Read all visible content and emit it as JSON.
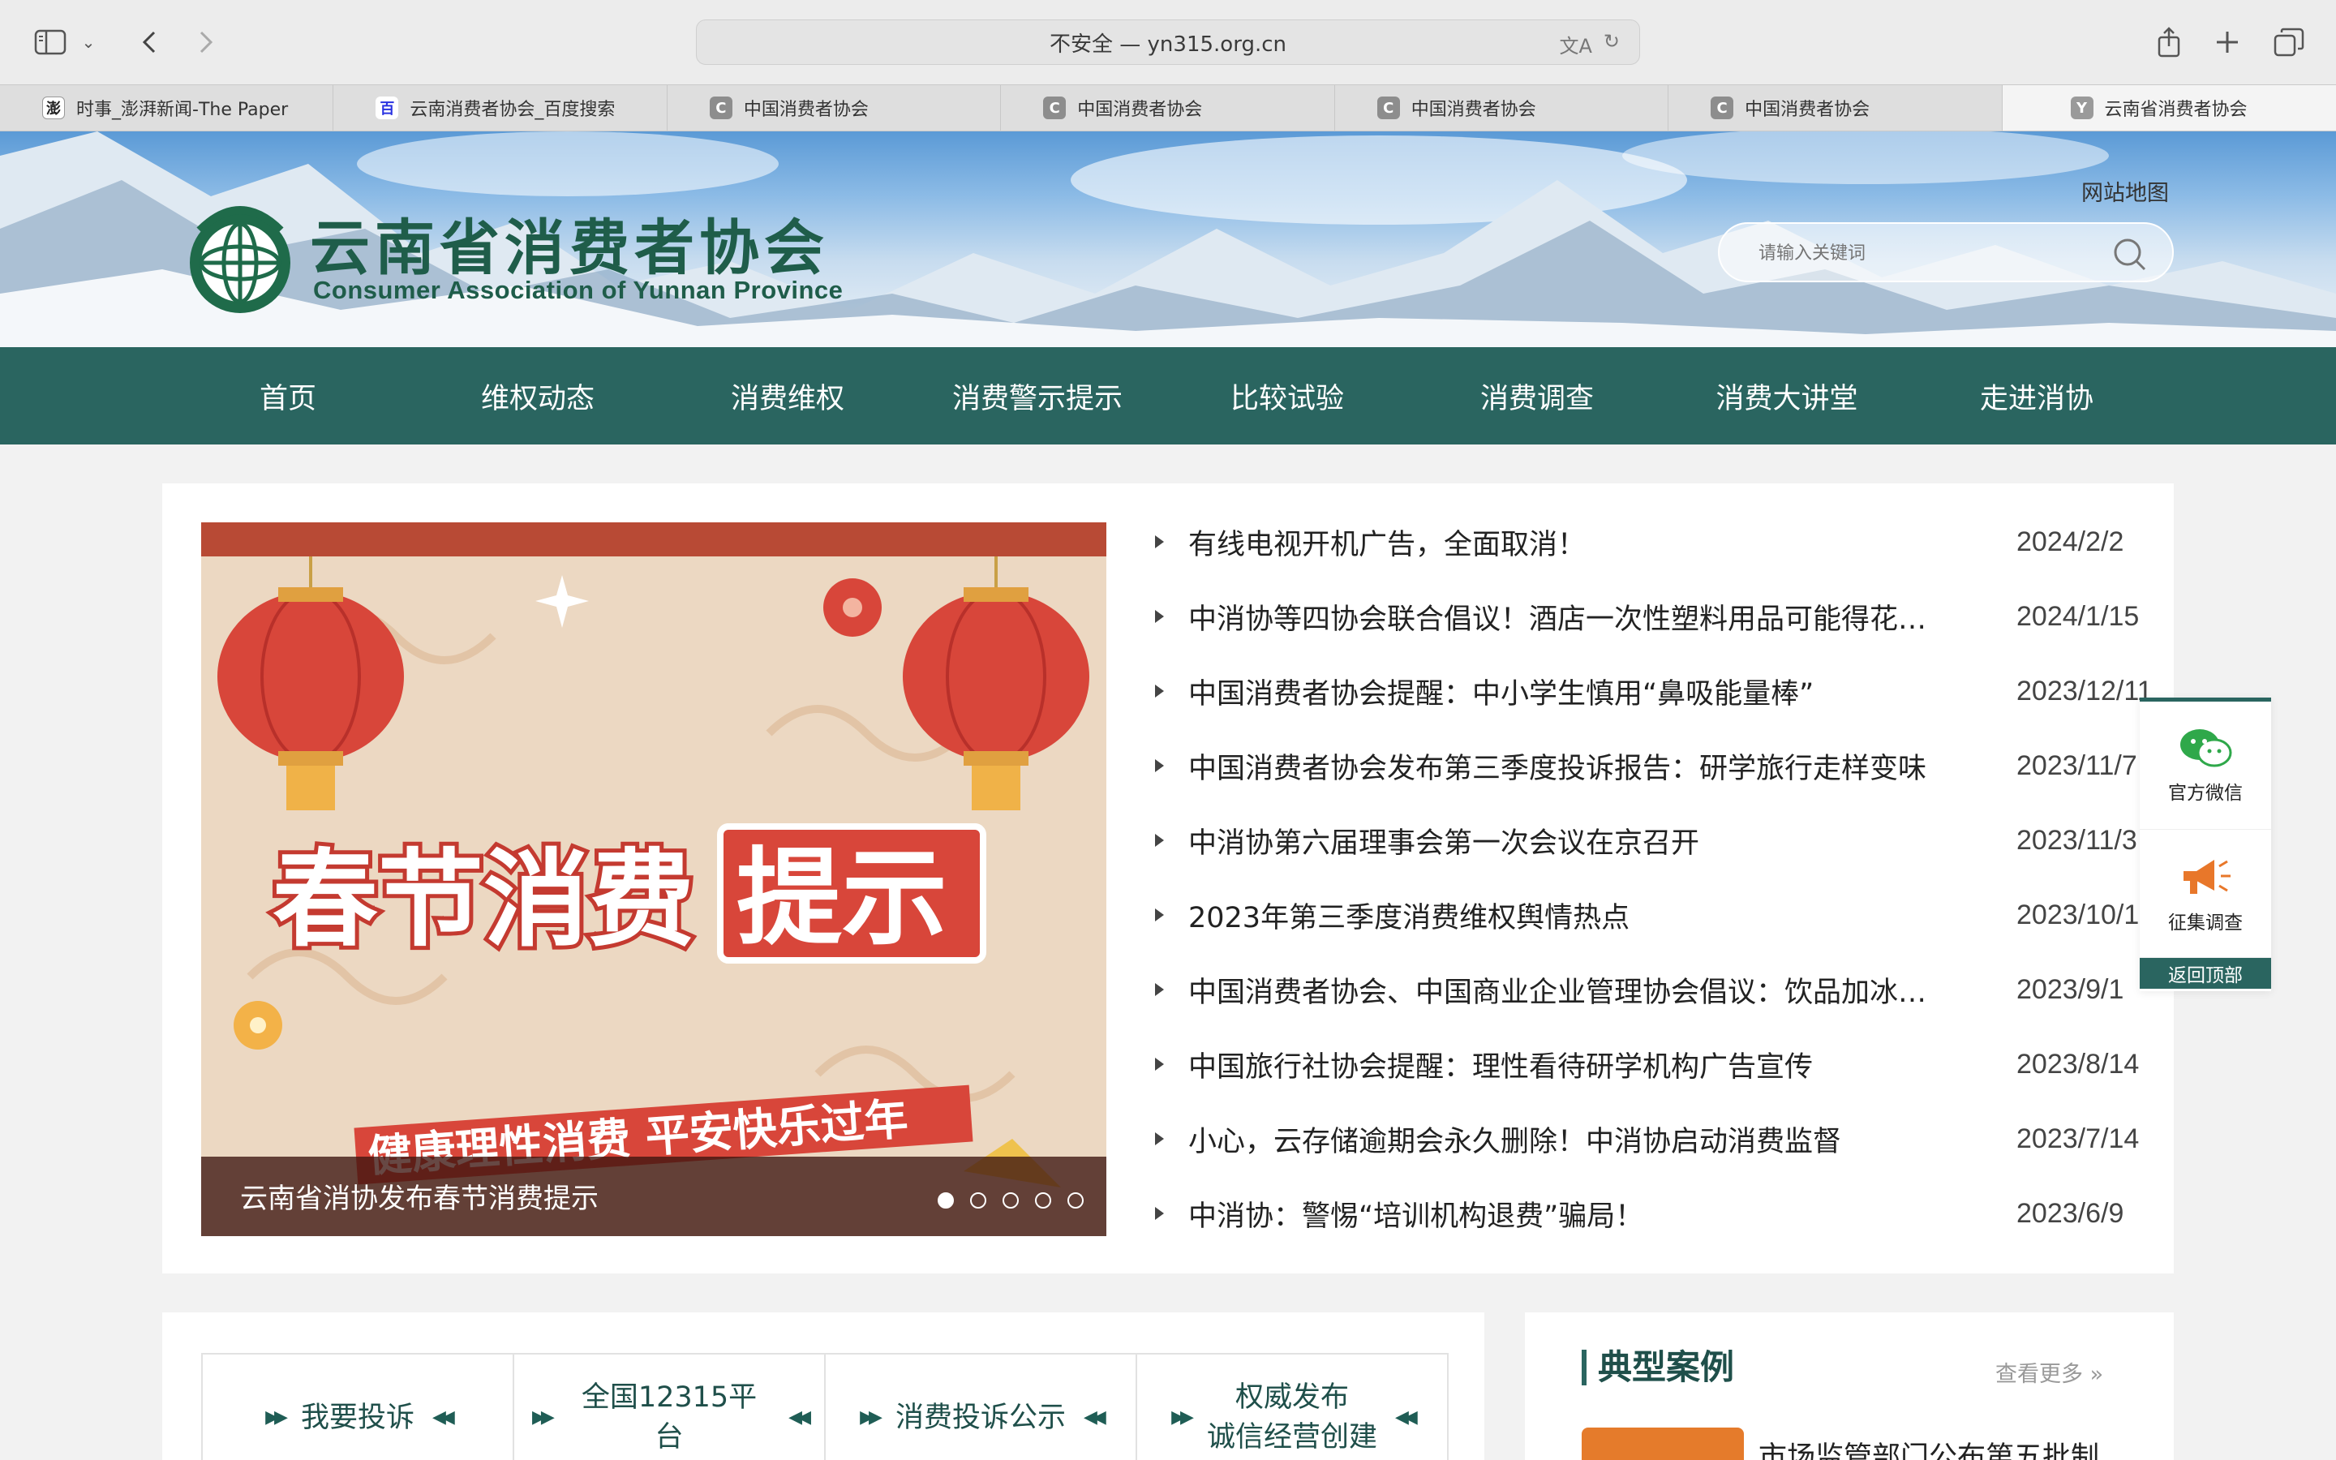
{
  "browser": {
    "address": "不安全 — yn315.org.cn",
    "tabs": [
      {
        "label": "时事_澎湃新闻-The Paper",
        "icon": "paper-favicon",
        "fav": "澎"
      },
      {
        "label": "云南消费者协会_百度搜索",
        "icon": "baidu-favicon",
        "fav": "百"
      },
      {
        "label": "中国消费者协会",
        "icon": "c-favicon",
        "fav": "C"
      },
      {
        "label": "中国消费者协会",
        "icon": "c-favicon",
        "fav": "C"
      },
      {
        "label": "中国消费者协会",
        "icon": "c-favicon",
        "fav": "C"
      },
      {
        "label": "中国消费者协会",
        "icon": "c-favicon",
        "fav": "C"
      },
      {
        "label": "云南省消费者协会",
        "icon": "y-favicon",
        "fav": "Y"
      }
    ]
  },
  "header": {
    "title": "云南省消费者协会",
    "subtitle": "Consumer Association of Yunnan Province",
    "sitemap": "网站地图",
    "search_placeholder": "请输入关键词"
  },
  "nav": [
    "首页",
    "维权动态",
    "消费维权",
    "消费警示提示",
    "比较试验",
    "消费调查",
    "消费大讲堂",
    "走进消协"
  ],
  "carousel": {
    "caption": "云南省消协发布春节消费提示",
    "slide_headline_a": "春节消费",
    "slide_headline_b": "提示",
    "slide_ribbon": "健康理性消费  平安快乐过年",
    "slide_count": 5,
    "active_index": 0
  },
  "news": [
    {
      "title": "有线电视开机广告，全面取消！",
      "date": "2024/2/2"
    },
    {
      "title": "中消协等四协会联合倡议！酒店一次性塑料用品可能得花钱了",
      "date": "2024/1/15"
    },
    {
      "title": "中国消费者协会提醒：中小学生慎用“鼻吸能量棒”",
      "date": "2023/12/11"
    },
    {
      "title": "中国消费者协会发布第三季度投诉报告：研学旅行走样变味",
      "date": "2023/11/7"
    },
    {
      "title": "中消协第六届理事会第一次会议在京召开",
      "date": "2023/11/3"
    },
    {
      "title": "2023年第三季度消费维权舆情热点",
      "date": "2023/10/1"
    },
    {
      "title": "中国消费者协会、中国商业企业管理协会倡议：饮品加冰量透明",
      "date": "2023/9/1"
    },
    {
      "title": "中国旅行社协会提醒：理性看待研学机构广告宣传",
      "date": "2023/8/14"
    },
    {
      "title": "小心，云存储逾期会永久删除！中消协启动消费监督",
      "date": "2023/7/14"
    },
    {
      "title": "中消协：警惕“培训机构退费”骗局！",
      "date": "2023/6/9"
    }
  ],
  "float": {
    "wechat": "官方微信",
    "survey": "征集调查",
    "back_top": "返回顶部"
  },
  "quick_links": [
    "我要投诉",
    "全国12315平台",
    "消费投诉公示",
    "权威发布\n诚信经营创建"
  ],
  "cases": {
    "title": "典型案例",
    "more": "查看更多 »",
    "first_item": "市场监管部门公布第五批制"
  },
  "colors": {
    "nav_bg": "#2a6560",
    "brand_green": "#1f5d4a"
  }
}
